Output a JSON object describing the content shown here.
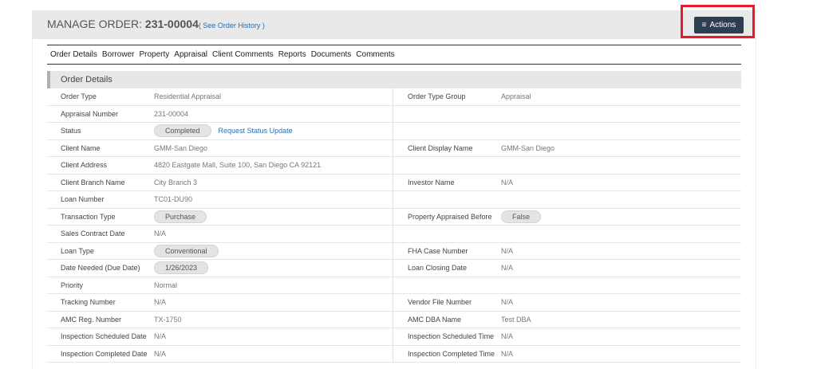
{
  "header": {
    "title_prefix": "MANAGE ORDER: ",
    "order_number": "231-00004",
    "history_open": "( ",
    "history_link": "See Order History",
    "history_close": " )",
    "actions_label": "Actions"
  },
  "tabs": [
    "Order Details",
    "Borrower",
    "Property",
    "Appraisal",
    "Client Comments",
    "Reports",
    "Documents",
    "Comments"
  ],
  "section": {
    "title": "Order Details"
  },
  "rows": [
    {
      "l1": "Order Type",
      "v1": "Residential Appraisal",
      "l2": "Order Type Group",
      "v2": "Appraisal"
    },
    {
      "l1": "Appraisal Number",
      "v1": "231-00004",
      "l2": "",
      "v2": ""
    },
    {
      "l1": "Status",
      "v1": "Completed",
      "v1_link": "Request Status Update",
      "l2": "",
      "v2": ""
    },
    {
      "l1": "Client Name",
      "v1": "GMM-San Diego",
      "l2": "Client Display Name",
      "v2": "GMM-San Diego"
    },
    {
      "l1": "Client Address",
      "v1": "4820 Eastgate Mall, Suite 100, San Diego CA 92121",
      "l2": "",
      "v2": ""
    },
    {
      "l1": "Client Branch Name",
      "v1": "City Branch 3",
      "l2": "Investor Name",
      "v2": "N/A"
    },
    {
      "l1": "Loan Number",
      "v1": "TC01-DU90",
      "l2": "",
      "v2": ""
    },
    {
      "l1": "Transaction Type",
      "v1": "Purchase",
      "l2": "Property Appraised Before",
      "v2": "False"
    },
    {
      "l1": "Sales Contract Date",
      "v1": "N/A",
      "l2": "",
      "v2": ""
    },
    {
      "l1": "Loan Type",
      "v1": "Conventional",
      "l2": "FHA Case Number",
      "v2": "N/A"
    },
    {
      "l1": "Date Needed (Due Date)",
      "v1": "1/26/2023",
      "l2": "Loan Closing Date",
      "v2": "N/A"
    },
    {
      "l1": "Priority",
      "v1": "Normal",
      "l2": "",
      "v2": ""
    },
    {
      "l1": "Tracking Number",
      "v1": "N/A",
      "l2": "Vendor File Number",
      "v2": "N/A"
    },
    {
      "l1": "AMC Reg. Number",
      "v1": "TX-1750",
      "l2": "AMC DBA Name",
      "v2": "Test DBA"
    },
    {
      "l1": "Inspection Scheduled Date",
      "v1": "N/A",
      "l2": "Inspection Scheduled Time",
      "v2": "N/A"
    },
    {
      "l1": "Inspection Completed Date",
      "v1": "N/A",
      "l2": "Inspection Completed Time",
      "v2": "N/A"
    }
  ],
  "colors": {
    "actions_bg": "#2d3e50",
    "highlight": "#e8192c",
    "link": "#2a6db0"
  },
  "icons": {
    "actions": "hamburger-menu-icon"
  }
}
